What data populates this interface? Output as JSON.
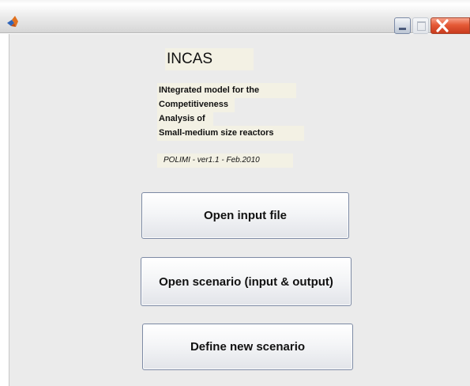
{
  "colors": {
    "window_background": "#ebebeb",
    "label_background": "#f3f1e4",
    "close_button": "#e55a37"
  },
  "titlebar": {
    "app_icon": "matlab-icon",
    "minimize_icon": "minimize-icon",
    "maximize_icon": "maximize-icon",
    "close_icon": "close-icon"
  },
  "header": {
    "title": "INCAS",
    "description_lines": [
      "INtegrated model for the",
      "Competitiveness",
      "Analysis of",
      "Small-medium size reactors"
    ],
    "version": "POLIMI - ver1.1 - Feb.2010"
  },
  "actions": {
    "open_input_file": "Open input file",
    "open_scenario": "Open scenario (input & output)",
    "define_new_scenario": "Define new scenario"
  }
}
